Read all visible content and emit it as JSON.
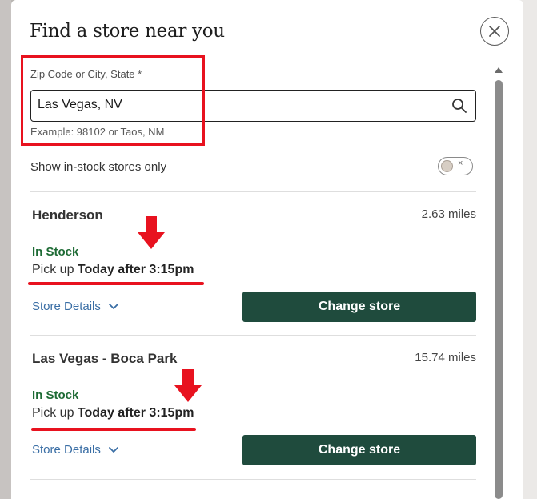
{
  "modal": {
    "title": "Find a store near you",
    "close_icon": "close-icon"
  },
  "search": {
    "label": "Zip Code or City, State *",
    "value": "Las Vegas, NV",
    "hint": "Example: 98102 or Taos, NM",
    "icon": "search-icon"
  },
  "filter": {
    "label": "Show in-stock stores only",
    "toggle_state": "off",
    "toggle_glyph": "×"
  },
  "stores": [
    {
      "name": "Henderson",
      "distance": "2.63 miles",
      "stock": "In Stock",
      "pickup_prefix": "Pick up",
      "pickup_time": "Today after 3:15pm",
      "details_label": "Store Details",
      "button_label": "Change store"
    },
    {
      "name": "Las Vegas - Boca Park",
      "distance": "15.74 miles",
      "stock": "In Stock",
      "pickup_prefix": "Pick up",
      "pickup_time": "Today after 3:15pm",
      "details_label": "Store Details",
      "button_label": "Change store"
    }
  ],
  "colors": {
    "accent_button": "#1f4b3d",
    "in_stock": "#1e6b35",
    "link": "#3a6ea5",
    "annotation": "#e8121f"
  }
}
